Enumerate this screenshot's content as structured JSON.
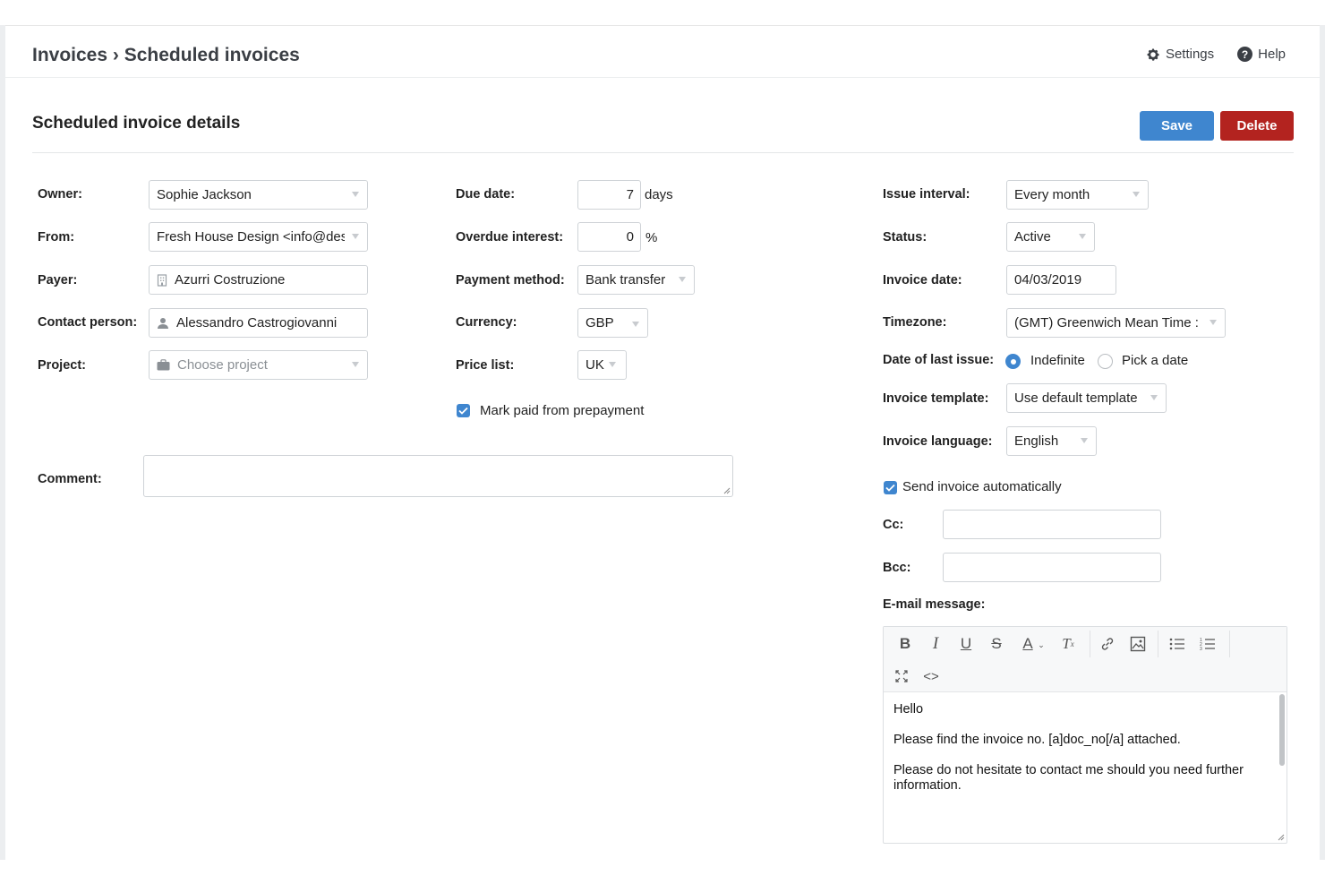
{
  "breadcrumb": {
    "root": "Invoices",
    "separator": "›",
    "current": "Scheduled invoices"
  },
  "toplinks": {
    "settings": "Settings",
    "help": "Help"
  },
  "section": {
    "title": "Scheduled invoice details",
    "save": "Save",
    "delete": "Delete"
  },
  "left": {
    "owner": {
      "label": "Owner:",
      "value": "Sophie Jackson"
    },
    "from": {
      "label": "From:",
      "value": "Fresh House Design <info@des"
    },
    "payer": {
      "label": "Payer:",
      "value": "Azurri Costruzione"
    },
    "contact": {
      "label": "Contact person:",
      "value": "Alessandro Castrogiovanni"
    },
    "project": {
      "label": "Project:",
      "placeholder": "Choose project"
    },
    "comment": {
      "label": "Comment:",
      "value": ""
    }
  },
  "middle": {
    "due_date": {
      "label": "Due date:",
      "value": "7",
      "suffix": "days"
    },
    "overdue": {
      "label": "Overdue interest:",
      "value": "0",
      "suffix": "%"
    },
    "payment": {
      "label": "Payment method:",
      "value": "Bank transfer"
    },
    "currency": {
      "label": "Currency:",
      "value": "GBP"
    },
    "pricelist": {
      "label": "Price list:",
      "value": "UK"
    },
    "mark_paid": {
      "label": "Mark paid from prepayment",
      "checked": true
    }
  },
  "right": {
    "interval": {
      "label": "Issue interval:",
      "value": "Every month"
    },
    "status": {
      "label": "Status:",
      "value": "Active"
    },
    "invoice_date": {
      "label": "Invoice date:",
      "value": "04/03/2019"
    },
    "timezone": {
      "label": "Timezone:",
      "value": "(GMT) Greenwich Mean Time :"
    },
    "last_issue": {
      "label": "Date of last issue:",
      "option1": "Indefinite",
      "option2": "Pick a date",
      "selected": "Indefinite"
    },
    "template": {
      "label": "Invoice template:",
      "value": "Use default template"
    },
    "language": {
      "label": "Invoice language:",
      "value": "English"
    },
    "send_auto": {
      "label": "Send invoice automatically",
      "checked": true
    },
    "cc": {
      "label": "Cc:",
      "value": ""
    },
    "bcc": {
      "label": "Bcc:",
      "value": ""
    },
    "email": {
      "label": "E-mail message:",
      "line1": "Hello",
      "line2": "Please find the invoice no. [a]doc_no[/a] attached.",
      "line3": "Please do not hesitate to contact me should you need further information."
    }
  },
  "colors": {
    "primary": "#3f86cf",
    "danger": "#b3231f"
  }
}
